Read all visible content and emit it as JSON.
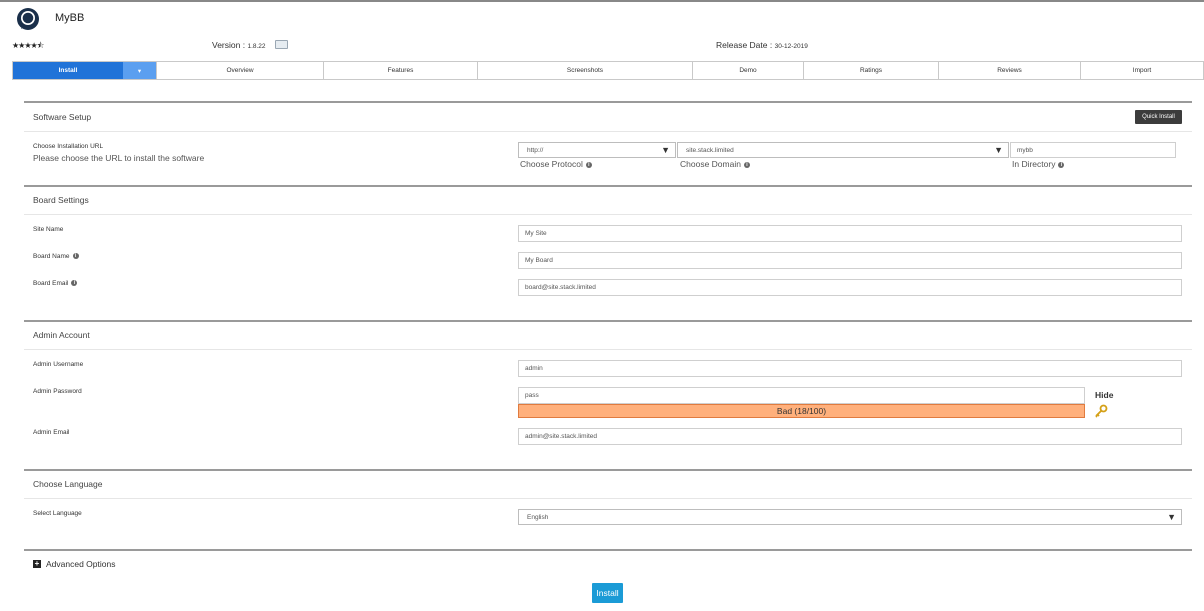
{
  "header": {
    "title": "MyBB",
    "rating_stars": "★★★★⯪",
    "version_label": "Version :",
    "version_value": "1.8.22",
    "release_label": "Release Date :",
    "release_value": "30-12-2019"
  },
  "tabs": [
    {
      "label": "Install"
    },
    {
      "label": "▾"
    },
    {
      "label": "Overview"
    },
    {
      "label": "Features"
    },
    {
      "label": "Screenshots"
    },
    {
      "label": "Demo"
    },
    {
      "label": "Ratings"
    },
    {
      "label": "Reviews"
    },
    {
      "label": "Import"
    }
  ],
  "software_setup": {
    "title": "Software Setup",
    "quick_install": "Quick Install",
    "url_label": "Choose Installation URL",
    "url_hint": "Please choose the URL to install the software",
    "protocol_value": "http://",
    "protocol_label": "Choose Protocol",
    "domain_value": "site.stack.limited",
    "domain_label": "Choose Domain",
    "directory_value": "mybb",
    "directory_label": "In Directory"
  },
  "board_settings": {
    "title": "Board Settings",
    "site_name_label": "Site Name",
    "site_name_value": "My Site",
    "board_name_label": "Board Name",
    "board_name_value": "My Board",
    "board_email_label": "Board Email",
    "board_email_value": "board@site.stack.limited"
  },
  "admin_account": {
    "title": "Admin Account",
    "username_label": "Admin Username",
    "username_value": "admin",
    "password_label": "Admin Password",
    "password_value": "pass",
    "hide_label": "Hide",
    "strength_text": "Bad (18/100)",
    "email_label": "Admin Email",
    "email_value": "admin@site.stack.limited"
  },
  "language": {
    "title": "Choose Language",
    "select_label": "Select Language",
    "selected": "English"
  },
  "advanced_label": "Advanced Options",
  "install_button": "Install",
  "colors": {
    "tab_active": "#2173d8",
    "strength_bad": "#ffb07c",
    "install_button": "#1b9bd6"
  }
}
